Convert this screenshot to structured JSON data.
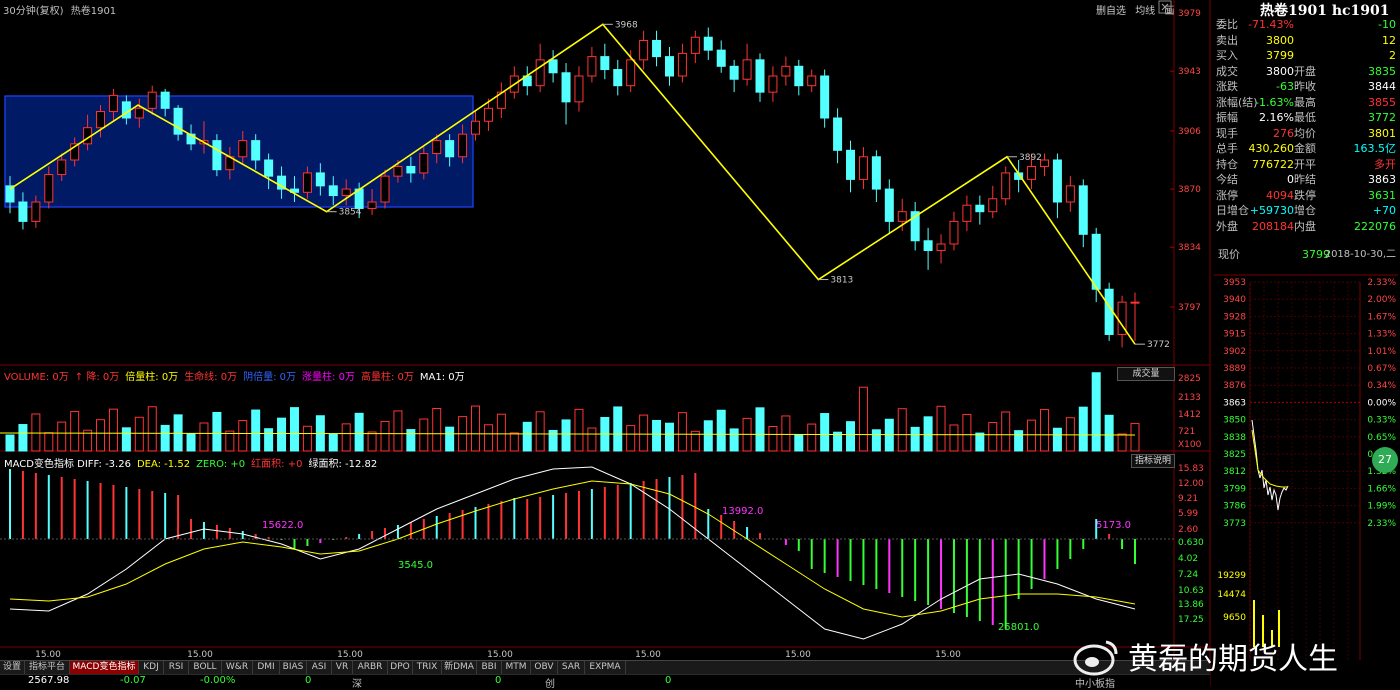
{
  "header": {
    "period": "30分钟(复权)",
    "contract_name": "热卷1901",
    "toolbar": [
      "删自选",
      "均线",
      "画"
    ],
    "title": "热卷1901 hc1901"
  },
  "quote": [
    {
      "label": "委比",
      "value": "-71.43%",
      "value2": "-10",
      "value_color": "#ff3333",
      "value2_color": "#33ff33"
    },
    {
      "label": "卖出",
      "value": "3800",
      "value2": "12",
      "value_color": "#ffff00",
      "value2_color": "#ffff00"
    },
    {
      "label": "买入",
      "value": "3799",
      "value2": "2",
      "value_color": "#ffff00",
      "value2_color": "#ffff00"
    },
    {
      "label": "成交",
      "value": "3800",
      "label2": "开盘",
      "value2": "3835",
      "value_color": "#ffffff",
      "value2_color": "#33ff33"
    },
    {
      "label": "涨跌",
      "value": "-63",
      "label2": "昨收",
      "value2": "3844",
      "value_color": "#33ff33",
      "value2_color": "#ffffff"
    },
    {
      "label": "涨幅(结)",
      "value": "-1.63%",
      "label2": "最高",
      "value2": "3855",
      "value_color": "#33ff33",
      "value2_color": "#ff3333"
    },
    {
      "label": "振幅",
      "value": "2.16%",
      "label2": "最低",
      "value2": "3772",
      "value_color": "#ffffff",
      "value2_color": "#33ff33"
    },
    {
      "label": "现手",
      "value": "276",
      "label2": "均价",
      "value2": "3801",
      "value_color": "#ff3333",
      "value2_color": "#ffff00"
    },
    {
      "label": "总手",
      "value": "430,260",
      "label2": "金额",
      "value2": "163.5亿",
      "value_color": "#ffff00",
      "value2_color": "#00ffff"
    },
    {
      "label": "持仓",
      "value": "776722",
      "label2": "开平",
      "value2": "多开",
      "value_color": "#ffff00",
      "value2_color": "#ff3333"
    },
    {
      "label": "今结",
      "value": "0",
      "label2": "昨结",
      "value2": "3863",
      "value_color": "#ffffff",
      "value2_color": "#ffffff"
    },
    {
      "label": "涨停",
      "value": "4094",
      "label2": "跌停",
      "value2": "3631",
      "value_color": "#ff3333",
      "value2_color": "#33ff33"
    },
    {
      "label": "日增仓",
      "value": "+59730",
      "label2": "增仓",
      "value2": "+70",
      "value_color": "#00ffff",
      "value2_color": "#00ffff"
    },
    {
      "label": "外盘",
      "value": "208184",
      "label2": "内盘",
      "value2": "222076",
      "value_color": "#ff3333",
      "value2_color": "#33ff33"
    }
  ],
  "price_row": {
    "label": "现价",
    "price": "3799",
    "datetime": "2018-10-30,二"
  },
  "intraday": {
    "left_ticks": [
      "3953",
      "3940",
      "3928",
      "3915",
      "3902",
      "3889",
      "3876",
      "3863",
      "3850",
      "3838",
      "3825",
      "3812",
      "3799",
      "3786",
      "3773"
    ],
    "right_ticks": [
      "2.33%",
      "2.00%",
      "1.67%",
      "1.33%",
      "1.01%",
      "0.67%",
      "0.34%",
      "0.00%",
      "0.33%",
      "0.65%",
      "0.99%",
      "1.32%",
      "1.66%",
      "1.99%",
      "2.33%"
    ],
    "vol_ticks": [
      "19299",
      "14474",
      "9650"
    ],
    "badge": "27"
  },
  "price_axis": [
    "3979",
    "3943",
    "3906",
    "3870",
    "3834",
    "3797"
  ],
  "volume": {
    "legend": [
      {
        "text": "VOLUME: 0万",
        "color": "#ff3333"
      },
      {
        "text": "↑ 降: 0万",
        "color": "#ff3333"
      },
      {
        "text": "倍量柱: 0万",
        "color": "#ffff00"
      },
      {
        "text": "生命线: 0万",
        "color": "#ff3333"
      },
      {
        "text": "阴倍量: 0万",
        "color": "#3366ff"
      },
      {
        "text": "涨量柱: 0万",
        "color": "#ff00ff"
      },
      {
        "text": "高量柱: 0万",
        "color": "#ff3333"
      },
      {
        "text": "MA1: 0万",
        "color": "#ffffff"
      }
    ],
    "dropdown": "成交量",
    "axis": [
      "2825",
      "2133",
      "1412",
      "721",
      "X100"
    ]
  },
  "macd": {
    "legend": [
      {
        "text": "MACD变色指标  DIFF: -3.26",
        "color": "#ffffff"
      },
      {
        "text": "DEA: -1.52",
        "color": "#ffff00"
      },
      {
        "text": "ZERO: +0",
        "color": "#33ff33"
      },
      {
        "text": "红面积: +0",
        "color": "#ff3333"
      },
      {
        "text": "绿面积: -12.82",
        "color": "#ffffff"
      }
    ],
    "button": "指标说明",
    "axis": [
      "15.83",
      "12.00",
      "9.21",
      "5.99",
      "2.60",
      "0.630",
      "4.02",
      "7.24",
      "10.63",
      "13.86",
      "17.25"
    ],
    "annotations": [
      {
        "text": "15622.0",
        "color": "#ff33ff"
      },
      {
        "text": "3545.0",
        "color": "#33ff33"
      },
      {
        "text": "13992.0",
        "color": "#ff33ff"
      },
      {
        "text": "25801.0",
        "color": "#33ff33"
      },
      {
        "text": "5173.0",
        "color": "#ff33ff"
      }
    ]
  },
  "time_axis": [
    "15.00",
    "15.00",
    "15.00",
    "15.00",
    "15.00",
    "15.00",
    "15.00"
  ],
  "price_labels": [
    {
      "text": "3968"
    },
    {
      "text": "3854"
    },
    {
      "text": "3813"
    },
    {
      "text": "3892"
    },
    {
      "text": "3772"
    }
  ],
  "tabs": [
    "设置",
    "指标平台",
    "MACD变色指标",
    "KDJ",
    "RSI",
    "BOLL",
    "W&R",
    "DMI",
    "BIAS",
    "ASI",
    "VR",
    "ARBR",
    "DPO",
    "TRIX",
    "新DMA",
    "BBI",
    "MTM",
    "OBV",
    "SAR",
    "EXPMA"
  ],
  "status": [
    {
      "text": "2567.98",
      "color": "#ffffff"
    },
    {
      "text": "-0.07",
      "color": "#33ff33"
    },
    {
      "text": "-0.00%",
      "color": "#33ff33"
    },
    {
      "text": "0",
      "color": "#33ff33"
    },
    {
      "text": "深",
      "color": "#c0c0c0"
    },
    {
      "text": "0",
      "color": "#33ff33"
    },
    {
      "text": "创",
      "color": "#c0c0c0"
    },
    {
      "text": "0",
      "color": "#33ff33"
    },
    {
      "text": "中小板指",
      "color": "#c0c0c0"
    }
  ],
  "watermark": "黄磊的期货人生",
  "colors": {
    "up": "#ff3333",
    "down": "#54ffff",
    "wave": "#ffff00",
    "box": "#001a66",
    "boxline": "#2244ff",
    "grid": "#7a0000"
  }
}
